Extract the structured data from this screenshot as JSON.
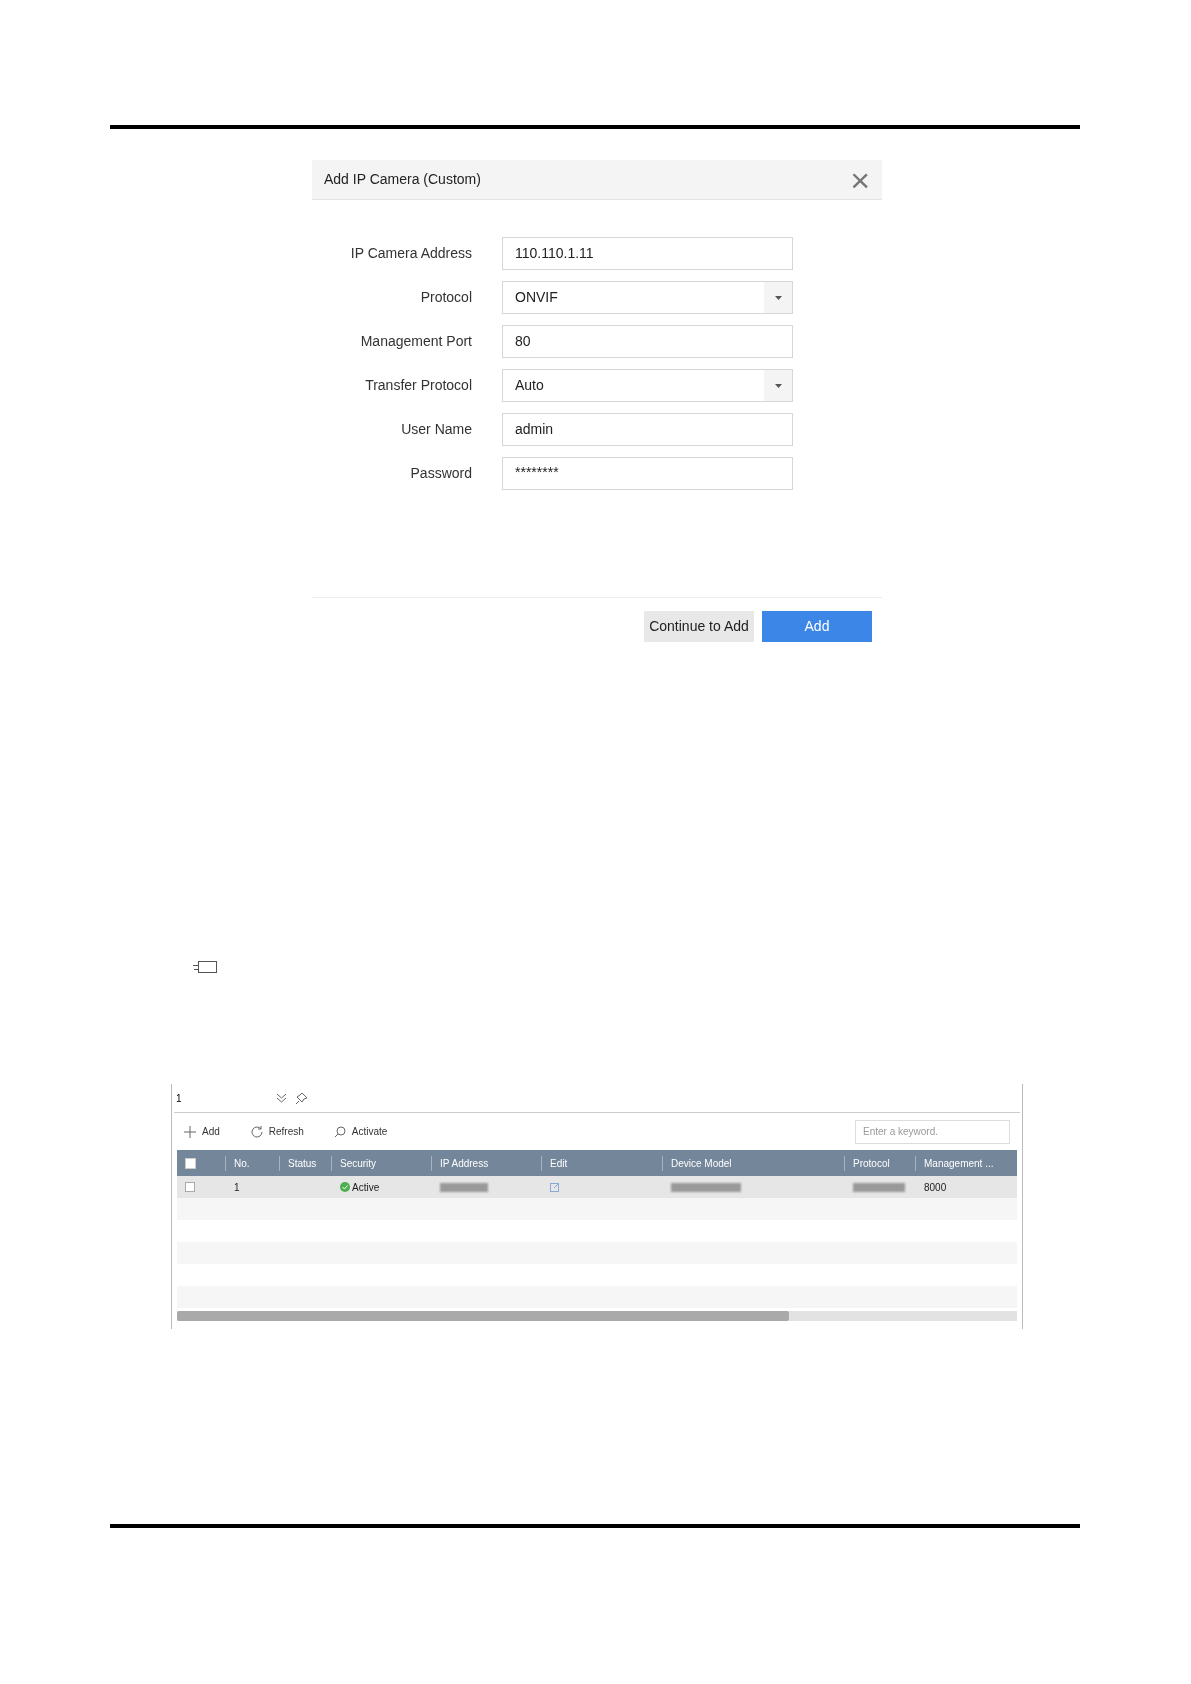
{
  "dialog": {
    "title": "Add IP Camera (Custom)",
    "close_glyph": "×",
    "fields": [
      {
        "label": "IP Camera Address",
        "value": "110.110.1.11",
        "kind": "text"
      },
      {
        "label": "Protocol",
        "value": "ONVIF",
        "kind": "dropdown"
      },
      {
        "label": "Management Port",
        "value": "80",
        "kind": "text"
      },
      {
        "label": "Transfer Protocol",
        "value": "Auto",
        "kind": "dropdown"
      },
      {
        "label": "User Name",
        "value": "admin",
        "kind": "text"
      },
      {
        "label": "Password",
        "value": "********",
        "kind": "password"
      }
    ],
    "buttons": [
      {
        "label": "Continue to Add",
        "kind": "secondary"
      },
      {
        "label": "Add",
        "kind": "primary"
      }
    ]
  },
  "device_list": {
    "count": "1",
    "toolbar": [
      {
        "label": "Add",
        "kind": "add"
      },
      {
        "label": "Refresh",
        "kind": "refresh"
      },
      {
        "label": "Activate",
        "kind": "activate"
      }
    ],
    "search": {
      "placeholder": "Enter a keyword."
    },
    "select_all_checked": false,
    "columns": [
      "No.",
      "Status",
      "Security",
      "IP Address",
      "Edit",
      "Device Model",
      "Protocol",
      "Management ..."
    ],
    "rows": [
      {
        "selected": true,
        "checked": false,
        "no": "1",
        "security": "Active",
        "management_port": "8000"
      }
    ]
  }
}
